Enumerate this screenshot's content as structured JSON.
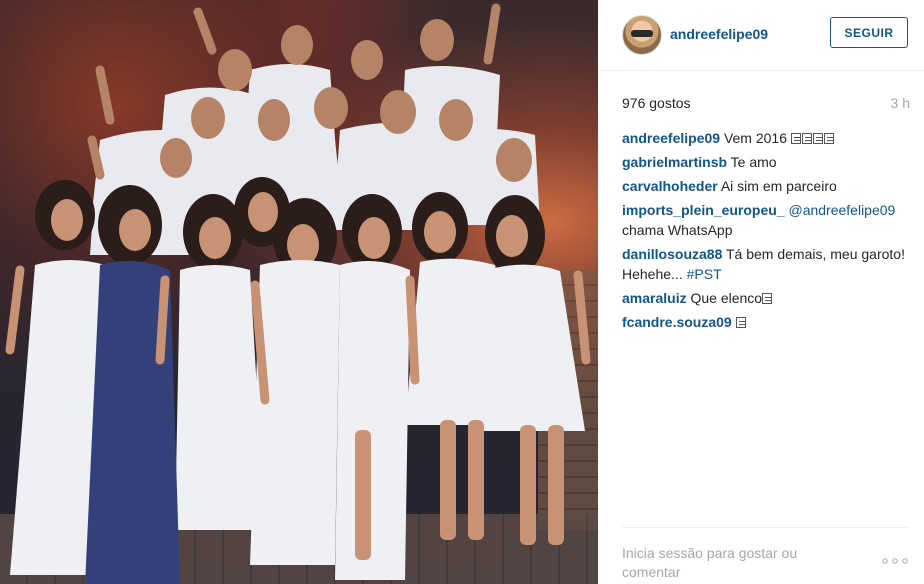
{
  "post": {
    "image_alt_people": "",
    "username": "andreefelipe09",
    "follow_label": "SEGUIR",
    "likes": "976 gostos",
    "time_ago": "3 h"
  },
  "comments": [
    {
      "user": "andreefelipe09",
      "text": "Vem 2016",
      "emoji_count": 4
    },
    {
      "user": "gabrielmartinsb",
      "text": "Te amo",
      "emoji_count": 0
    },
    {
      "user": "carvalhoheder",
      "text": "Ai sim em parceiro",
      "emoji_count": 0
    },
    {
      "user": "imports_plein_europeu_",
      "mention": "@andreefelipe09",
      "text": "chama WhatsApp",
      "emoji_count": 0
    },
    {
      "user": "danillosouza88",
      "text": "Tá bem demais, meu garoto! Hehehe...",
      "hashtag": "#PST",
      "emoji_count": 0
    },
    {
      "user": "amaraluiz",
      "text": "Que elenco",
      "emoji_count": 1
    },
    {
      "user": "fcandre.souza09",
      "text": "",
      "emoji_count": 1
    }
  ],
  "footer": {
    "login_prompt": "Inicia sessão para gostar ou comentar"
  },
  "icons": {
    "more": "more-options-icon",
    "avatar": "profile-avatar"
  },
  "colors": {
    "link": "#125688",
    "muted": "#a5a7aa",
    "text": "#262626"
  }
}
